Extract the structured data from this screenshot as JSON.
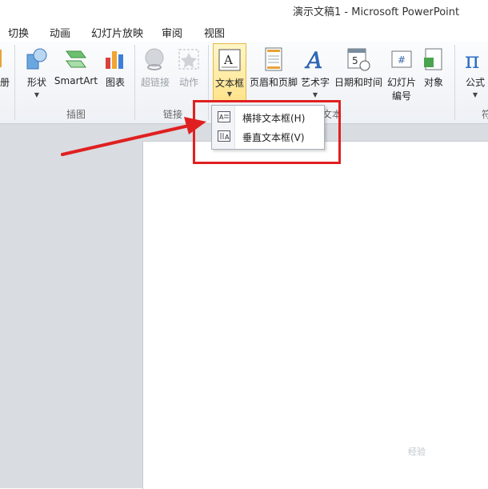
{
  "window": {
    "title": "演示文稿1 - Microsoft PowerPoint"
  },
  "tabs": [
    "切换",
    "动画",
    "幻灯片放映",
    "审阅",
    "视图"
  ],
  "ribbon": {
    "partial_left_label": "册",
    "illustrations": {
      "buttons": [
        {
          "label": "形状"
        },
        {
          "label": "SmartArt"
        },
        {
          "label": "图表"
        }
      ],
      "group_label": "插图"
    },
    "links": {
      "buttons": [
        {
          "label": "超链接"
        },
        {
          "label": "动作"
        }
      ],
      "group_label": "链接"
    },
    "text": {
      "buttons": [
        {
          "label": "文本框"
        },
        {
          "label": "页眉和页脚"
        },
        {
          "label": "艺术字"
        },
        {
          "label": "日期和时间"
        },
        {
          "label": "幻灯片",
          "label2": "编号"
        },
        {
          "label": "对象"
        }
      ],
      "group_label": "文本"
    },
    "symbols": {
      "buttons": [
        {
          "label": "公式"
        }
      ],
      "group_label_partial": "符"
    }
  },
  "textbox_menu": {
    "items": [
      {
        "label": "横排文本框(H)"
      },
      {
        "label": "垂直文本框(V)"
      }
    ]
  },
  "watermark": "经验"
}
